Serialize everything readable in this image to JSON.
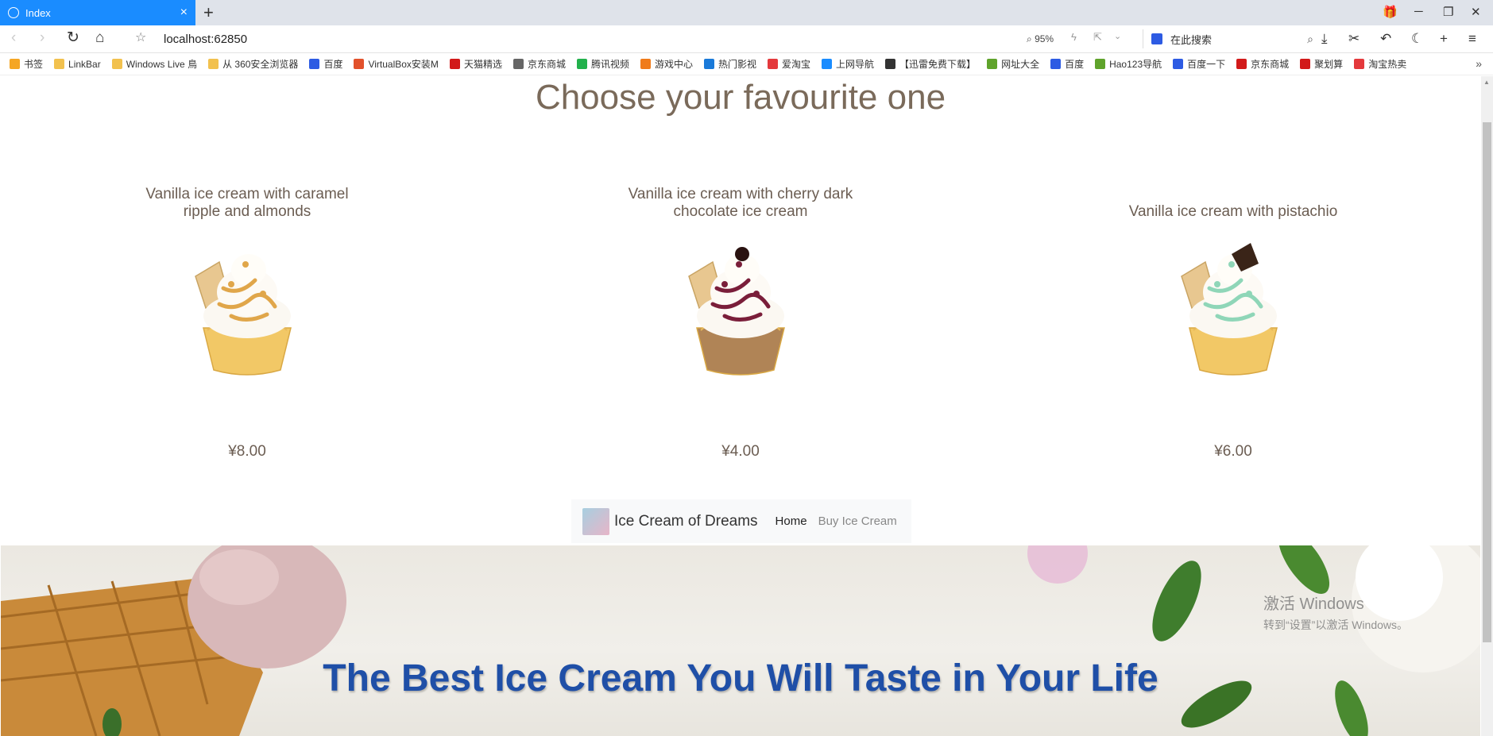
{
  "browser": {
    "tab_title": "Index",
    "url": "localhost:62850",
    "zoom": "95%",
    "search_placeholder": "在此搜索"
  },
  "bookmarks": [
    {
      "label": "书签",
      "icon": "star-icon",
      "color": "#f5a623"
    },
    {
      "label": "LinkBar",
      "icon": "folder-icon",
      "color": "#f2c14e"
    },
    {
      "label": "Windows Live 鳥",
      "icon": "folder-icon",
      "color": "#f2c14e"
    },
    {
      "label": "从 360安全浏览器",
      "icon": "folder-icon",
      "color": "#f2c14e"
    },
    {
      "label": "百度",
      "icon": "baidu-icon",
      "color": "#2d5be3"
    },
    {
      "label": "VirtualBox安装M",
      "icon": "c-icon",
      "color": "#e2512b"
    },
    {
      "label": "天猫精选",
      "icon": "tmall-icon",
      "color": "#d21a1a"
    },
    {
      "label": "京东商城",
      "icon": "globe-icon",
      "color": "#666666"
    },
    {
      "label": "腾讯视频",
      "icon": "play-icon",
      "color": "#22b14c"
    },
    {
      "label": "游戏中心",
      "icon": "gamepad-icon",
      "color": "#f07b1a"
    },
    {
      "label": "热门影视",
      "icon": "tv-icon",
      "color": "#1a7ad9"
    },
    {
      "label": "爱淘宝",
      "icon": "taobao-icon",
      "color": "#e4393c"
    },
    {
      "label": "上网导航",
      "icon": "q-icon",
      "color": "#1a8cff"
    },
    {
      "label": "【迅雷免费下载】",
      "icon": "xunlei-icon",
      "color": "#333333"
    },
    {
      "label": "网址大全",
      "icon": "hao-icon",
      "color": "#5fa32b"
    },
    {
      "label": "百度",
      "icon": "baidu-icon",
      "color": "#2d5be3"
    },
    {
      "label": "Hao123导航",
      "icon": "hao123-icon",
      "color": "#5fa32b"
    },
    {
      "label": "百度一下",
      "icon": "baidu-box-icon",
      "color": "#2d5be3"
    },
    {
      "label": "京东商城",
      "icon": "jd-icon",
      "color": "#d21a1a"
    },
    {
      "label": "聚划算",
      "icon": "juhuasuan-icon",
      "color": "#d21a1a"
    },
    {
      "label": "淘宝热卖",
      "icon": "taobao-icon",
      "color": "#e4393c"
    }
  ],
  "page": {
    "heading": "Choose your favourite one",
    "products": [
      {
        "name": "Vanilla ice cream with caramel ripple and almonds",
        "price": "¥8.00",
        "variant": "caramel",
        "color": "#e0a64a"
      },
      {
        "name": "Vanilla ice cream with cherry dark chocolate ice cream",
        "price": "¥4.00",
        "variant": "cherry",
        "color": "#7a1e3a"
      },
      {
        "name": "Vanilla ice cream with pistachio",
        "price": "¥6.00",
        "variant": "pistachio",
        "color": "#8fd6b8"
      }
    ],
    "navbar": {
      "brand": "Ice Cream of Dreams",
      "links": [
        "Home",
        "Buy Ice Cream"
      ]
    },
    "hero_title": "The Best Ice Cream You Will Taste in Your Life"
  },
  "watermark": {
    "line1": "激活 Windows",
    "line2": "转到“设置”以激活 Windows。"
  },
  "colors": {
    "tab_active": "#1a8cff",
    "heading": "#7a6a5a",
    "hero_title": "#1f4fa7"
  }
}
